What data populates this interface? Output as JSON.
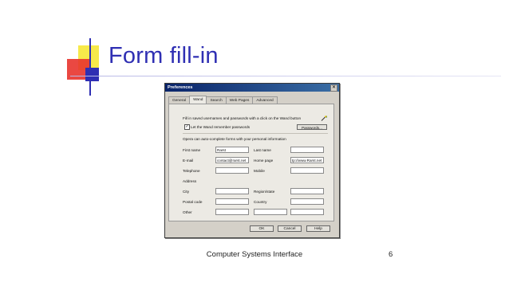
{
  "slide": {
    "title": "Form fill-in",
    "footer": "Computer Systems Interface",
    "page_number": "6"
  },
  "dialog": {
    "title": "Preferences",
    "close_glyph": "✕",
    "tabs": [
      "General",
      "Wand",
      "Search",
      "Web Pages",
      "Advanced"
    ],
    "active_tab": "Wand",
    "intro_text": "Fill in saved usernames and passwords with a click on the Wand button",
    "remember_label": "Let the Wand remember passwords",
    "remember_checked": true,
    "passwords_button": "Passwords...",
    "section_text": "Opera can auto-complete forms with your personal information",
    "fields": {
      "first_name": {
        "label": "First name",
        "value": "Rarst"
      },
      "last_name": {
        "label": "Last name",
        "value": ""
      },
      "email": {
        "label": "E-mail",
        "value": "contact@rarst.net"
      },
      "home_page": {
        "label": "Home page",
        "value": "tp://www.Rarst.net"
      },
      "telephone": {
        "label": "Telephone",
        "value": ""
      },
      "mobile": {
        "label": "Mobile",
        "value": ""
      },
      "address": {
        "label": "Address",
        "value": ""
      },
      "city": {
        "label": "City",
        "value": ""
      },
      "region": {
        "label": "Region/state",
        "value": ""
      },
      "postal_code": {
        "label": "Postal code",
        "value": ""
      },
      "country": {
        "label": "Country",
        "value": ""
      },
      "other": {
        "label": "Other",
        "value": ""
      }
    },
    "buttons": {
      "ok": "OK",
      "cancel": "Cancel",
      "help": "Help"
    },
    "icons": {
      "wand": "wand-icon",
      "close": "close-icon"
    }
  },
  "colors": {
    "title_blue": "#2f2fb3",
    "titlebar": "#0a246a"
  }
}
